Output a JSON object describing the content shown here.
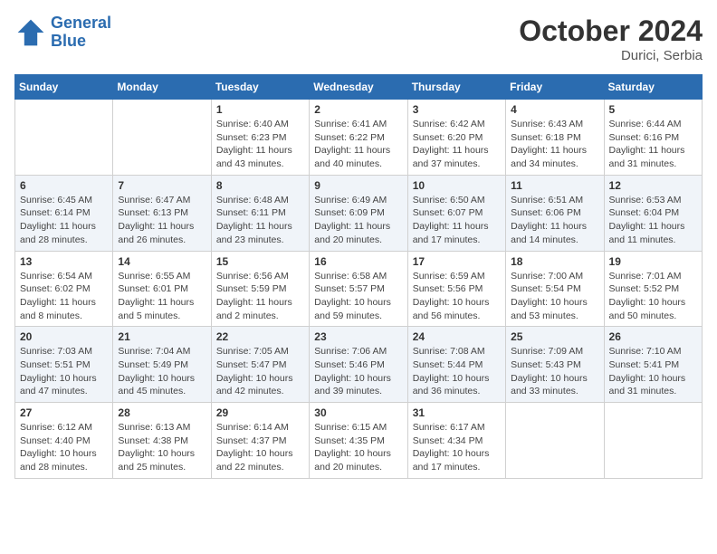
{
  "header": {
    "logo_line1": "General",
    "logo_line2": "Blue",
    "month": "October 2024",
    "location": "Durici, Serbia"
  },
  "days_of_week": [
    "Sunday",
    "Monday",
    "Tuesday",
    "Wednesday",
    "Thursday",
    "Friday",
    "Saturday"
  ],
  "weeks": [
    [
      {
        "day": "",
        "sunrise": "",
        "sunset": "",
        "daylight": ""
      },
      {
        "day": "",
        "sunrise": "",
        "sunset": "",
        "daylight": ""
      },
      {
        "day": "1",
        "sunrise": "Sunrise: 6:40 AM",
        "sunset": "Sunset: 6:23 PM",
        "daylight": "Daylight: 11 hours and 43 minutes."
      },
      {
        "day": "2",
        "sunrise": "Sunrise: 6:41 AM",
        "sunset": "Sunset: 6:22 PM",
        "daylight": "Daylight: 11 hours and 40 minutes."
      },
      {
        "day": "3",
        "sunrise": "Sunrise: 6:42 AM",
        "sunset": "Sunset: 6:20 PM",
        "daylight": "Daylight: 11 hours and 37 minutes."
      },
      {
        "day": "4",
        "sunrise": "Sunrise: 6:43 AM",
        "sunset": "Sunset: 6:18 PM",
        "daylight": "Daylight: 11 hours and 34 minutes."
      },
      {
        "day": "5",
        "sunrise": "Sunrise: 6:44 AM",
        "sunset": "Sunset: 6:16 PM",
        "daylight": "Daylight: 11 hours and 31 minutes."
      }
    ],
    [
      {
        "day": "6",
        "sunrise": "Sunrise: 6:45 AM",
        "sunset": "Sunset: 6:14 PM",
        "daylight": "Daylight: 11 hours and 28 minutes."
      },
      {
        "day": "7",
        "sunrise": "Sunrise: 6:47 AM",
        "sunset": "Sunset: 6:13 PM",
        "daylight": "Daylight: 11 hours and 26 minutes."
      },
      {
        "day": "8",
        "sunrise": "Sunrise: 6:48 AM",
        "sunset": "Sunset: 6:11 PM",
        "daylight": "Daylight: 11 hours and 23 minutes."
      },
      {
        "day": "9",
        "sunrise": "Sunrise: 6:49 AM",
        "sunset": "Sunset: 6:09 PM",
        "daylight": "Daylight: 11 hours and 20 minutes."
      },
      {
        "day": "10",
        "sunrise": "Sunrise: 6:50 AM",
        "sunset": "Sunset: 6:07 PM",
        "daylight": "Daylight: 11 hours and 17 minutes."
      },
      {
        "day": "11",
        "sunrise": "Sunrise: 6:51 AM",
        "sunset": "Sunset: 6:06 PM",
        "daylight": "Daylight: 11 hours and 14 minutes."
      },
      {
        "day": "12",
        "sunrise": "Sunrise: 6:53 AM",
        "sunset": "Sunset: 6:04 PM",
        "daylight": "Daylight: 11 hours and 11 minutes."
      }
    ],
    [
      {
        "day": "13",
        "sunrise": "Sunrise: 6:54 AM",
        "sunset": "Sunset: 6:02 PM",
        "daylight": "Daylight: 11 hours and 8 minutes."
      },
      {
        "day": "14",
        "sunrise": "Sunrise: 6:55 AM",
        "sunset": "Sunset: 6:01 PM",
        "daylight": "Daylight: 11 hours and 5 minutes."
      },
      {
        "day": "15",
        "sunrise": "Sunrise: 6:56 AM",
        "sunset": "Sunset: 5:59 PM",
        "daylight": "Daylight: 11 hours and 2 minutes."
      },
      {
        "day": "16",
        "sunrise": "Sunrise: 6:58 AM",
        "sunset": "Sunset: 5:57 PM",
        "daylight": "Daylight: 10 hours and 59 minutes."
      },
      {
        "day": "17",
        "sunrise": "Sunrise: 6:59 AM",
        "sunset": "Sunset: 5:56 PM",
        "daylight": "Daylight: 10 hours and 56 minutes."
      },
      {
        "day": "18",
        "sunrise": "Sunrise: 7:00 AM",
        "sunset": "Sunset: 5:54 PM",
        "daylight": "Daylight: 10 hours and 53 minutes."
      },
      {
        "day": "19",
        "sunrise": "Sunrise: 7:01 AM",
        "sunset": "Sunset: 5:52 PM",
        "daylight": "Daylight: 10 hours and 50 minutes."
      }
    ],
    [
      {
        "day": "20",
        "sunrise": "Sunrise: 7:03 AM",
        "sunset": "Sunset: 5:51 PM",
        "daylight": "Daylight: 10 hours and 47 minutes."
      },
      {
        "day": "21",
        "sunrise": "Sunrise: 7:04 AM",
        "sunset": "Sunset: 5:49 PM",
        "daylight": "Daylight: 10 hours and 45 minutes."
      },
      {
        "day": "22",
        "sunrise": "Sunrise: 7:05 AM",
        "sunset": "Sunset: 5:47 PM",
        "daylight": "Daylight: 10 hours and 42 minutes."
      },
      {
        "day": "23",
        "sunrise": "Sunrise: 7:06 AM",
        "sunset": "Sunset: 5:46 PM",
        "daylight": "Daylight: 10 hours and 39 minutes."
      },
      {
        "day": "24",
        "sunrise": "Sunrise: 7:08 AM",
        "sunset": "Sunset: 5:44 PM",
        "daylight": "Daylight: 10 hours and 36 minutes."
      },
      {
        "day": "25",
        "sunrise": "Sunrise: 7:09 AM",
        "sunset": "Sunset: 5:43 PM",
        "daylight": "Daylight: 10 hours and 33 minutes."
      },
      {
        "day": "26",
        "sunrise": "Sunrise: 7:10 AM",
        "sunset": "Sunset: 5:41 PM",
        "daylight": "Daylight: 10 hours and 31 minutes."
      }
    ],
    [
      {
        "day": "27",
        "sunrise": "Sunrise: 6:12 AM",
        "sunset": "Sunset: 4:40 PM",
        "daylight": "Daylight: 10 hours and 28 minutes."
      },
      {
        "day": "28",
        "sunrise": "Sunrise: 6:13 AM",
        "sunset": "Sunset: 4:38 PM",
        "daylight": "Daylight: 10 hours and 25 minutes."
      },
      {
        "day": "29",
        "sunrise": "Sunrise: 6:14 AM",
        "sunset": "Sunset: 4:37 PM",
        "daylight": "Daylight: 10 hours and 22 minutes."
      },
      {
        "day": "30",
        "sunrise": "Sunrise: 6:15 AM",
        "sunset": "Sunset: 4:35 PM",
        "daylight": "Daylight: 10 hours and 20 minutes."
      },
      {
        "day": "31",
        "sunrise": "Sunrise: 6:17 AM",
        "sunset": "Sunset: 4:34 PM",
        "daylight": "Daylight: 10 hours and 17 minutes."
      },
      {
        "day": "",
        "sunrise": "",
        "sunset": "",
        "daylight": ""
      },
      {
        "day": "",
        "sunrise": "",
        "sunset": "",
        "daylight": ""
      }
    ]
  ]
}
